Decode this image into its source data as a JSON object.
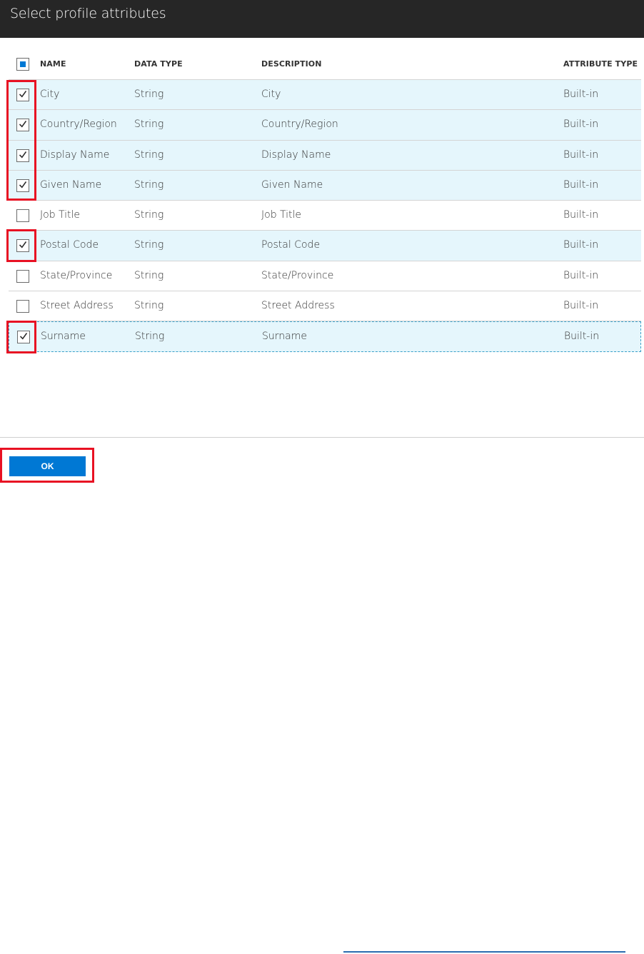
{
  "header": {
    "title": "Select profile attributes"
  },
  "columns": {
    "name": "NAME",
    "data_type": "DATA TYPE",
    "description": "DESCRIPTION",
    "attribute_type": "ATTRIBUTE TYPE"
  },
  "rows": [
    {
      "name": "City",
      "data_type": "String",
      "description": "City",
      "attribute_type": "Built-in",
      "checked": true
    },
    {
      "name": "Country/Region",
      "data_type": "String",
      "description": "Country/Region",
      "attribute_type": "Built-in",
      "checked": true
    },
    {
      "name": "Display Name",
      "data_type": "String",
      "description": "Display Name",
      "attribute_type": "Built-in",
      "checked": true
    },
    {
      "name": "Given Name",
      "data_type": "String",
      "description": "Given Name",
      "attribute_type": "Built-in",
      "checked": true
    },
    {
      "name": "Job Title",
      "data_type": "String",
      "description": "Job Title",
      "attribute_type": "Built-in",
      "checked": false
    },
    {
      "name": "Postal Code",
      "data_type": "String",
      "description": "Postal Code",
      "attribute_type": "Built-in",
      "checked": true
    },
    {
      "name": "State/Province",
      "data_type": "String",
      "description": "State/Province",
      "attribute_type": "Built-in",
      "checked": false
    },
    {
      "name": "Street Address",
      "data_type": "String",
      "description": "Street Address",
      "attribute_type": "Built-in",
      "checked": false
    },
    {
      "name": "Surname",
      "data_type": "String",
      "description": "Surname",
      "attribute_type": "Built-in",
      "checked": true
    }
  ],
  "footer": {
    "ok_label": "OK"
  },
  "colors": {
    "header_bg": "#262626",
    "selected_row": "#e5f6fc",
    "accent": "#0078d4",
    "highlight": "#e81123"
  }
}
